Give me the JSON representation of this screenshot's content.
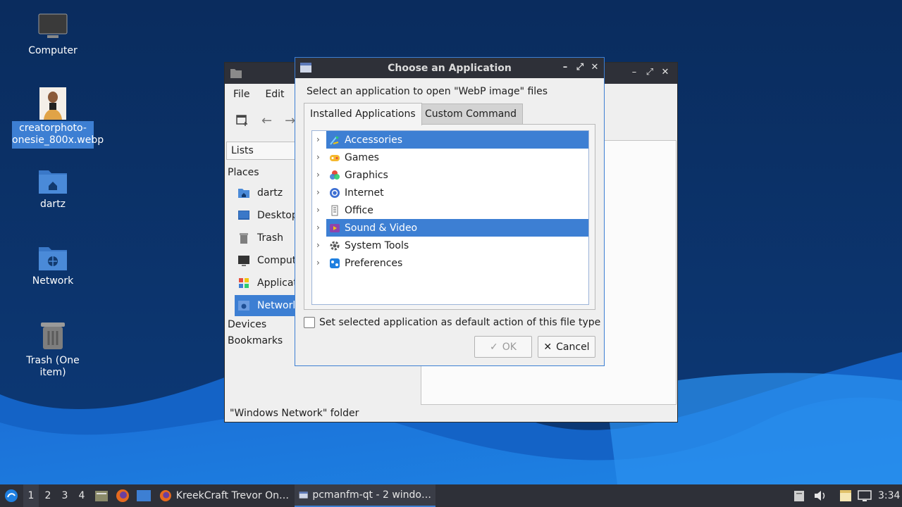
{
  "desktop": {
    "icons": [
      {
        "label": "Computer"
      },
      {
        "label": "creatorphoto-onesie_800x.webp"
      },
      {
        "label": "dartz"
      },
      {
        "label": "Network"
      },
      {
        "label": "Trash (One item)"
      }
    ]
  },
  "file_manager": {
    "menu": [
      "File",
      "Edit"
    ],
    "lists_label": "Lists",
    "places_heading": "Places",
    "places": [
      "dartz",
      "Desktop",
      "Trash",
      "Computer",
      "Applications",
      "Network"
    ],
    "devices_heading": "Devices",
    "bookmarks_heading": "Bookmarks",
    "status": "\"Windows Network\" folder"
  },
  "dialog": {
    "title": "Choose an Application",
    "prompt": "Select an application to open \"WebP image\" files",
    "tabs": [
      "Installed Applications",
      "Custom Command"
    ],
    "categories": [
      {
        "label": "Accessories",
        "icon": "accessories-icon"
      },
      {
        "label": "Games",
        "icon": "games-icon"
      },
      {
        "label": "Graphics",
        "icon": "graphics-icon"
      },
      {
        "label": "Internet",
        "icon": "internet-icon"
      },
      {
        "label": "Office",
        "icon": "office-icon"
      },
      {
        "label": "Sound & Video",
        "icon": "sound-video-icon"
      },
      {
        "label": "System Tools",
        "icon": "system-tools-icon"
      },
      {
        "label": "Preferences",
        "icon": "preferences-icon"
      }
    ],
    "default_checkbox_label": "Set selected application as default action of this file type",
    "ok_label": "OK",
    "cancel_label": "Cancel"
  },
  "taskbar": {
    "workspaces": [
      "1",
      "2",
      "3",
      "4"
    ],
    "tasks": [
      {
        "label": "KreekCraft Trevor On…"
      },
      {
        "label": "pcmanfm-qt - 2 windo…"
      }
    ],
    "clock": "3:34"
  },
  "colors": {
    "accent": "#3d7fd3",
    "titlebar": "#2e3038",
    "wallpaper_dark": "#0a2e63",
    "wallpaper_light": "#1e7fe0"
  }
}
